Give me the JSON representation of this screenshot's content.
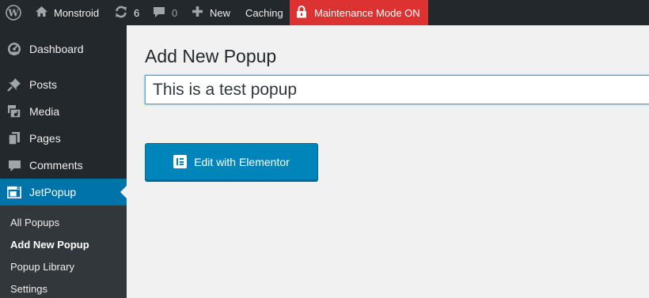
{
  "adminbar": {
    "site_name": "Monstroid",
    "updates_count": "6",
    "comments_count": "0",
    "new_label": "New",
    "caching_label": "Caching",
    "maintenance_label": "Maintenance Mode ON",
    "maintenance_color": "#dc3232"
  },
  "sidebar": {
    "items": [
      {
        "label": "Dashboard",
        "icon": "dashboard-icon"
      },
      {
        "label": "Posts",
        "icon": "pin-icon"
      },
      {
        "label": "Media",
        "icon": "media-icon"
      },
      {
        "label": "Pages",
        "icon": "pages-icon"
      },
      {
        "label": "Comments",
        "icon": "comment-icon"
      },
      {
        "label": "JetPopup",
        "icon": "popup-icon"
      }
    ],
    "submenu": [
      {
        "label": "All Popups"
      },
      {
        "label": "Add New Popup"
      },
      {
        "label": "Popup Library"
      },
      {
        "label": "Settings"
      }
    ],
    "accent_color": "#0073aa"
  },
  "main": {
    "page_title": "Add New Popup",
    "title_value": "This is a test popup",
    "elementor_button_label": "Edit with Elementor"
  }
}
